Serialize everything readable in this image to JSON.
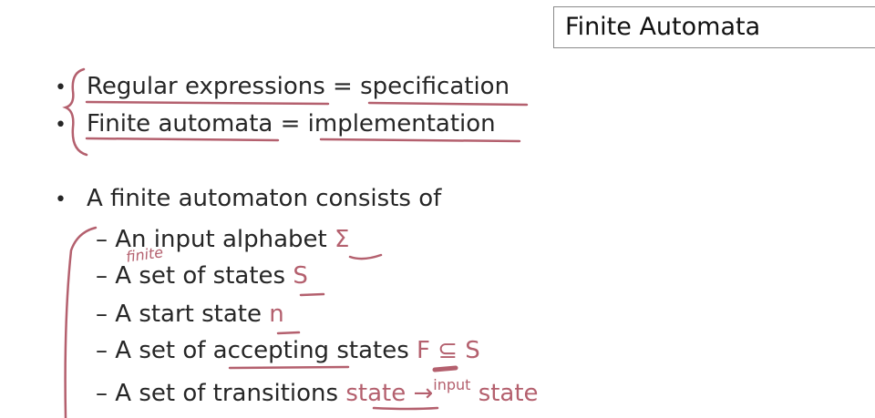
{
  "slide_title": "Finite Automata",
  "bullets": [
    {
      "text": "Regular expressions = specification"
    },
    {
      "text": "Finite automata = implementation"
    },
    {
      "text": "A finite automaton consists of"
    }
  ],
  "sub_items": [
    {
      "text": "An input alphabet ",
      "symbol": "Σ"
    },
    {
      "text": "A set of states ",
      "symbol": "S"
    },
    {
      "text": "A start state ",
      "symbol": "n"
    },
    {
      "text": "A set of accepting states ",
      "symbol": "F ⊆ S"
    },
    {
      "text": "A set of transitions ",
      "from": "state",
      "arrow": "→",
      "label": "input",
      "to": "state"
    }
  ],
  "bullet_char": "•",
  "dash_char": "–",
  "annotation_finite": "finite",
  "colors": {
    "ink": "#b4606e",
    "text": "#262626"
  }
}
